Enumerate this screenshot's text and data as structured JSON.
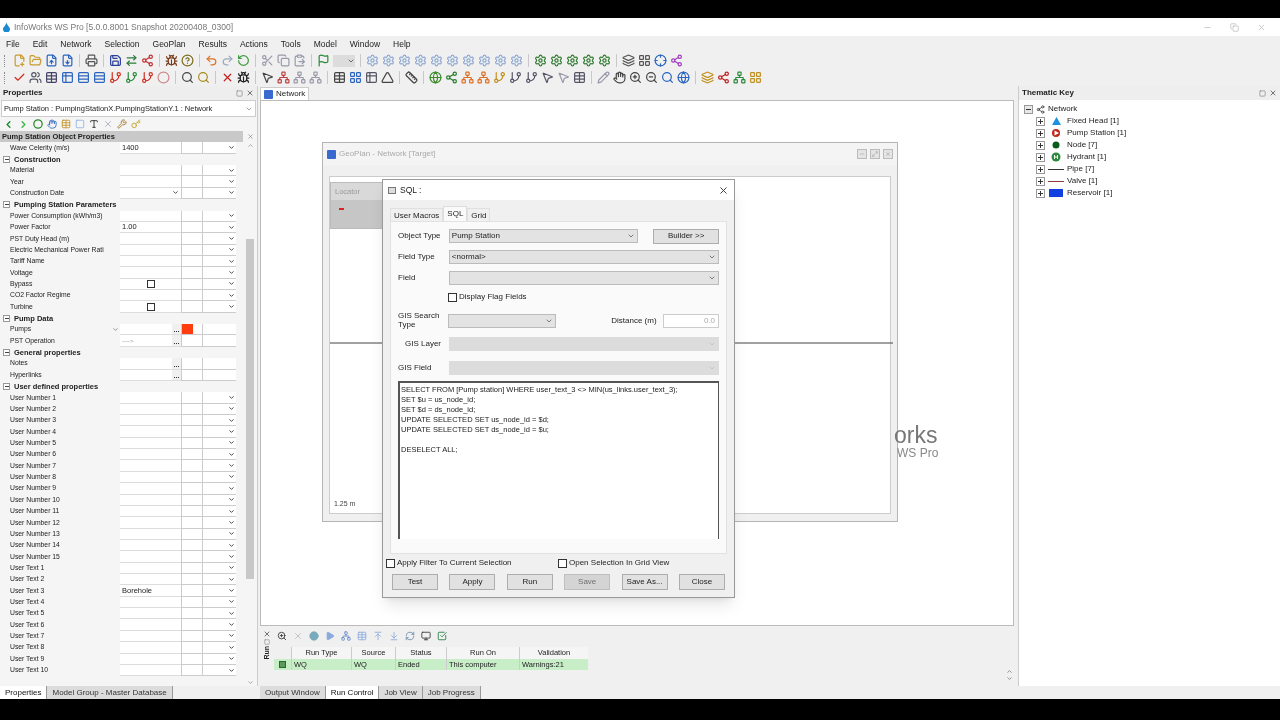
{
  "app": {
    "title": "InfoWorks WS Pro [5.0.0.8001 Snapshot 20200408_0300]"
  },
  "menu": [
    "File",
    "Edit",
    "Network",
    "Selection",
    "GeoPlan",
    "Results",
    "Actions",
    "Tools",
    "Model",
    "Window",
    "Help"
  ],
  "properties": {
    "title": "Properties",
    "object_selector": "Pump Station : PumpingStationX.PumpingStationY.1 : Network",
    "header": "Pump Station Object Properties",
    "items": [
      {
        "kind": "field",
        "label": "Wave Celerity (m/s)",
        "value": "1400"
      },
      {
        "kind": "section",
        "title": "Construction",
        "expanded": true,
        "children": [
          {
            "kind": "field",
            "label": "Material"
          },
          {
            "kind": "field",
            "label": "Year"
          },
          {
            "kind": "date",
            "label": "Construction Date"
          }
        ]
      },
      {
        "kind": "section",
        "title": "Pumping Station Parameters",
        "expanded": true,
        "children": [
          {
            "kind": "field",
            "label": "Power Consumption (kWh/m3)"
          },
          {
            "kind": "field",
            "label": "Power Factor",
            "value": "1.00"
          },
          {
            "kind": "field",
            "label": "PST Duty Head (m)"
          },
          {
            "kind": "field",
            "label": "Electric Mechanical Power Rati"
          },
          {
            "kind": "field",
            "label": "Tariff Name"
          },
          {
            "kind": "field",
            "label": "Voltage"
          },
          {
            "kind": "check",
            "label": "Bypass",
            "checked": false
          },
          {
            "kind": "field",
            "label": "CO2 Factor Regime"
          },
          {
            "kind": "check",
            "label": "Turbine",
            "checked": false
          }
        ]
      },
      {
        "kind": "section",
        "title": "Pump Data",
        "expanded": true,
        "children": [
          {
            "kind": "pumps",
            "label": "Pumps",
            "color": "#ff3b10"
          },
          {
            "kind": "link",
            "label": "PST Operation",
            "value": "---->"
          }
        ]
      },
      {
        "kind": "section",
        "title": "General properties",
        "expanded": true,
        "children": [
          {
            "kind": "notes",
            "label": "Notes"
          },
          {
            "kind": "notes",
            "label": "Hyperlinks"
          }
        ]
      },
      {
        "kind": "section",
        "title": "User defined properties",
        "expanded": true,
        "children": [
          {
            "kind": "field",
            "label": "User Number 1"
          },
          {
            "kind": "field",
            "label": "User Number 2"
          },
          {
            "kind": "field",
            "label": "User Number 3"
          },
          {
            "kind": "field",
            "label": "User Number 4"
          },
          {
            "kind": "field",
            "label": "User Number 5"
          },
          {
            "kind": "field",
            "label": "User Number 6"
          },
          {
            "kind": "field",
            "label": "User Number 7"
          },
          {
            "kind": "field",
            "label": "User Number 8"
          },
          {
            "kind": "field",
            "label": "User Number 9"
          },
          {
            "kind": "field",
            "label": "User Number 10"
          },
          {
            "kind": "field",
            "label": "User Number 11"
          },
          {
            "kind": "field",
            "label": "User Number 12"
          },
          {
            "kind": "field",
            "label": "User Number 13"
          },
          {
            "kind": "field",
            "label": "User Number 14"
          },
          {
            "kind": "field",
            "label": "User Number 15"
          },
          {
            "kind": "field",
            "label": "User Text 1"
          },
          {
            "kind": "field",
            "label": "User Text 2"
          },
          {
            "kind": "field",
            "label": "User Text 3",
            "value": "Borehole"
          },
          {
            "kind": "field",
            "label": "User Text 4"
          },
          {
            "kind": "field",
            "label": "User Text 5"
          },
          {
            "kind": "field",
            "label": "User Text 6"
          },
          {
            "kind": "field",
            "label": "User Text 7"
          },
          {
            "kind": "field",
            "label": "User Text 8"
          },
          {
            "kind": "field",
            "label": "User Text 9"
          },
          {
            "kind": "field",
            "label": "User Text 10"
          }
        ]
      }
    ]
  },
  "network_tab": "Network",
  "geoplan": {
    "title": "GeoPlan - Network [Target]",
    "locator": "Locator",
    "scale": "1.25 m",
    "logo_lines": [
      "orks",
      "WS Pro"
    ]
  },
  "sql_dialog": {
    "title": "SQL :",
    "tabs": [
      {
        "label": "User Macros",
        "selected": false
      },
      {
        "label": "SQL",
        "selected": true
      },
      {
        "label": "Grid",
        "selected": false
      }
    ],
    "object_type": {
      "label": "Object Type",
      "value": "Pump Station"
    },
    "builder_button": "Builder >>",
    "field_type": {
      "label": "Field Type",
      "value": "<normal>"
    },
    "field": {
      "label": "Field"
    },
    "display_flag_fields": {
      "label": "Display Flag Fields",
      "checked": false
    },
    "gis_search_type": {
      "label": "GIS Search Type"
    },
    "distance": {
      "label": "Distance (m)",
      "value": "0.0",
      "disabled": true
    },
    "gis_layer": {
      "label": "GIS Layer",
      "disabled": true
    },
    "gis_field": {
      "label": "GIS Field",
      "disabled": true
    },
    "query": "SELECT FROM [Pump station] WHERE user_text_3 <> MIN(us_links.user_text_3);\nSET $u = us_node_id;\nSET $d = ds_node_id;\nUPDATE SELECTED SET us_node_id = $d;\nUPDATE SELECTED SET ds_node_id = $u;\n\nDESELECT ALL;",
    "options": [
      {
        "label": "Apply Filter To Current Selection",
        "checked": false
      },
      {
        "label": "Open Selection In Grid View",
        "checked": false
      }
    ],
    "buttons": [
      {
        "label": "Test",
        "disabled": false
      },
      {
        "label": "Apply",
        "disabled": false
      },
      {
        "label": "Run",
        "disabled": false
      },
      {
        "label": "Save",
        "disabled": true
      },
      {
        "label": "Save As...",
        "disabled": false
      },
      {
        "label": "Close",
        "disabled": false
      }
    ]
  },
  "run_control": {
    "side_label": "Run",
    "columns": [
      "Run Type",
      "Source",
      "Status",
      "Run On",
      "Validation"
    ],
    "rows": [
      {
        "cells": [
          "WQ",
          "WQ",
          "Ended",
          "This computer",
          "Warnings:21"
        ],
        "selected": true
      }
    ]
  },
  "bottom_tabs_left": [
    {
      "label": "Properties",
      "selected": true
    },
    {
      "label": "Model Group - Master Database",
      "selected": false
    }
  ],
  "bottom_tabs_center": [
    {
      "label": "Output Window",
      "selected": false
    },
    {
      "label": "Run Control",
      "selected": true
    },
    {
      "label": "Job View",
      "selected": false
    },
    {
      "label": "Job Progress",
      "selected": false
    }
  ],
  "thematic_key": {
    "title": "Thematic Key",
    "root": {
      "label": "Network",
      "expanded": true,
      "children": [
        {
          "label": "Fixed Head [1]",
          "kind": "triangle",
          "color": "#1e90e0",
          "expanded": false
        },
        {
          "label": "Pump Station [1]",
          "kind": "pump",
          "color": "#c0281c",
          "expanded": false
        },
        {
          "label": "Node [7]",
          "kind": "dot",
          "color": "#0b5a1e",
          "expanded": false
        },
        {
          "label": "Hydrant [1]",
          "kind": "hydrant",
          "color": "#2e8b3e",
          "expanded": false
        },
        {
          "label": "Pipe [7]",
          "kind": "line",
          "color": "#333333",
          "expanded": false
        },
        {
          "label": "Valve [1]",
          "kind": "line",
          "color": "#8b3a3a",
          "expanded": false
        },
        {
          "label": "Reservoir [1]",
          "kind": "block",
          "color": "#1040e0",
          "expanded": false
        }
      ]
    }
  }
}
